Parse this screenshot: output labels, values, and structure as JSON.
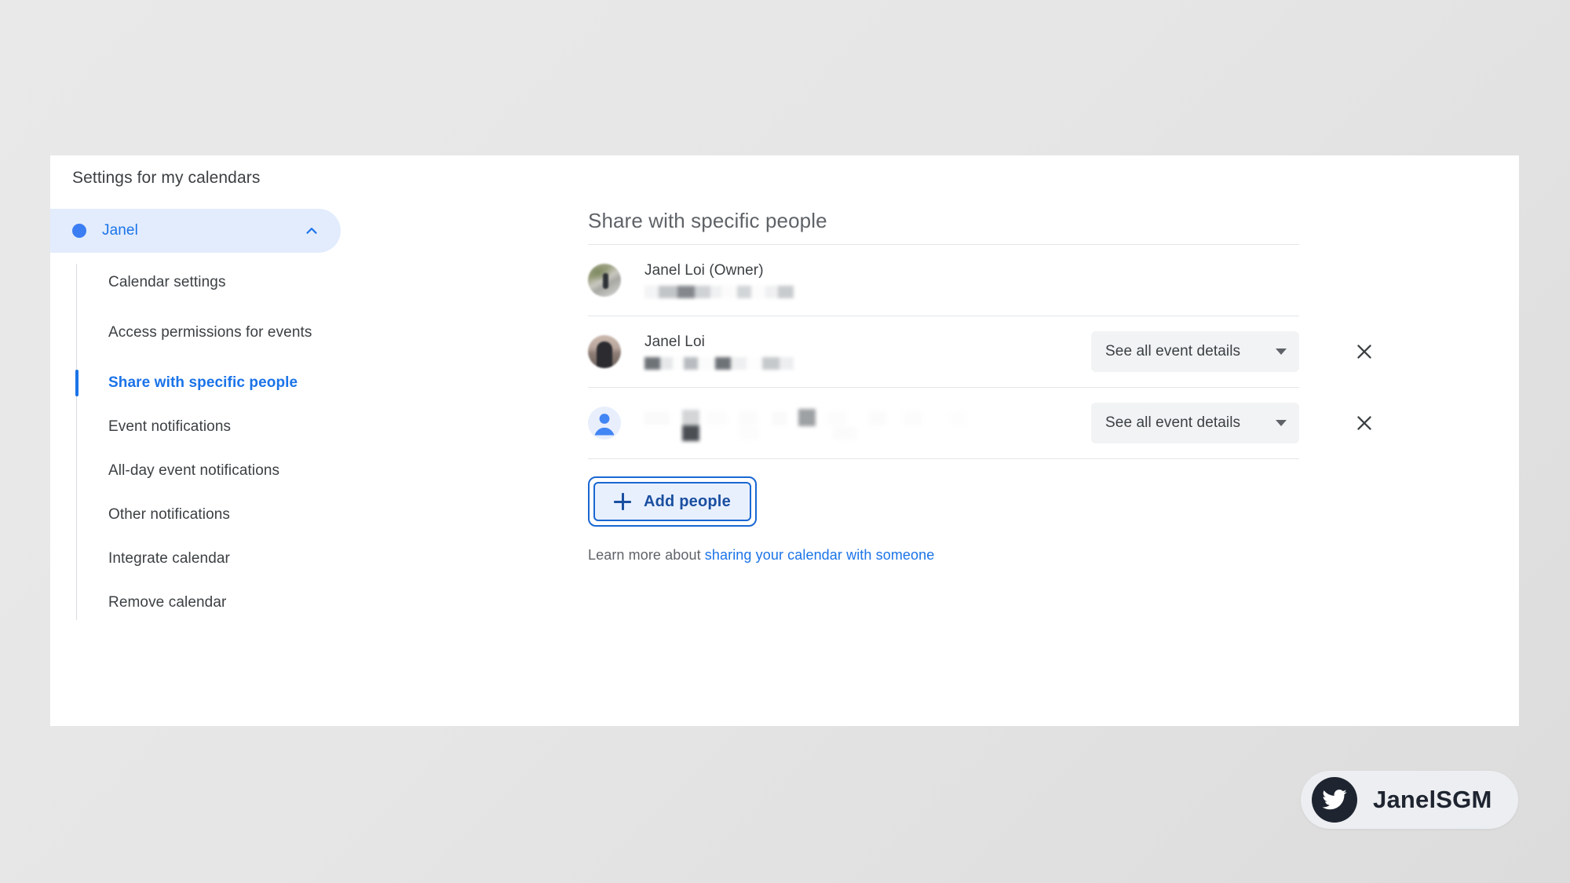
{
  "card": {
    "title": "Settings for my calendars"
  },
  "sidebar": {
    "calendar": {
      "name": "Janel",
      "dot_color": "#3b7df2",
      "expanded": true,
      "chevron": "chevron-up-icon"
    },
    "items": [
      {
        "label": "Calendar settings",
        "active": false
      },
      {
        "label": "Access permissions for events",
        "active": false
      },
      {
        "label": "Share with specific people",
        "active": true
      },
      {
        "label": "Event notifications",
        "active": false
      },
      {
        "label": "All-day event notifications",
        "active": false
      },
      {
        "label": "Other notifications",
        "active": false
      },
      {
        "label": "Integrate calendar",
        "active": false
      },
      {
        "label": "Remove calendar",
        "active": false
      }
    ]
  },
  "main": {
    "heading": "Share with specific people",
    "people": [
      {
        "name": "Janel Loi (Owner)",
        "email": "",
        "email_redacted": true,
        "avatar": "photo-avatar-road",
        "permission": null,
        "removable": false
      },
      {
        "name": "Janel Loi",
        "email": "",
        "email_redacted": true,
        "avatar": "photo-avatar-person",
        "permission": "See all event details",
        "removable": true
      },
      {
        "name": "",
        "name_redacted": true,
        "email": "",
        "email_redacted": true,
        "avatar": "default-user-icon",
        "permission": "See all event details",
        "removable": true
      }
    ],
    "add_people_label": "Add people",
    "add_people_icon": "plus-icon",
    "remove_icon": "close-icon",
    "dropdown_icon": "caret-down-icon",
    "learn_more_prefix": "Learn more about ",
    "learn_more_link": "sharing your calendar with someone"
  },
  "watermark": {
    "label": "JanelSGM",
    "icon": "twitter-bird-icon"
  },
  "colors": {
    "accent_blue": "#1a73e8",
    "pill_blue": "#e3ecfd",
    "button_fill": "#e8f0fe",
    "button_border": "#1967d2",
    "text_primary": "#3c4043",
    "text_secondary": "#5f6368",
    "divider": "#e4e6e8"
  }
}
